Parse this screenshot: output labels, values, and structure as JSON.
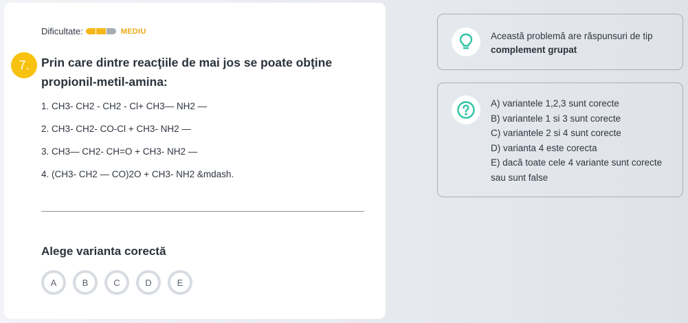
{
  "question": {
    "difficulty_label": "Dificultate:",
    "difficulty_level": "MEDIU",
    "difficulty_filled": 2,
    "difficulty_total": 3,
    "number": "7.",
    "title": "Prin care dintre reacţiile de mai jos se poate obţine propionil-metil-amina:",
    "options": [
      "1. CH3- CH2 - CH2 - Cl+ CH3— NH2 —",
      "2. CH3- CH2- CO-Cl + CH3- NH2 —",
      "3. CH3— CH2- CH=O + CH3- NH2 —",
      "4. (CH3- CH2 — CO)2O + CH3- NH2 &mdash."
    ],
    "choose_label": "Alege varianta corectă",
    "answers": [
      "A",
      "B",
      "C",
      "D",
      "E"
    ]
  },
  "info_type": {
    "icon": "lightbulb-icon",
    "text_prefix": "Această problemă are răspunsuri de tip",
    "text_bold": "complement grupat"
  },
  "info_legend": {
    "icon": "question-circle-icon",
    "items": [
      "A) variantele 1,2,3 sunt corecte",
      "B) variantele 1 si 3 sunt corecte",
      "C) variantele 2 si 4 sunt corecte",
      "D) varianta 4 este corecta",
      "E) dacă toate cele 4 variante sunt corecte",
      "sau sunt false"
    ]
  },
  "colors": {
    "accent_yellow": "#f8c20f",
    "icon_teal": "#2ec4a6"
  }
}
